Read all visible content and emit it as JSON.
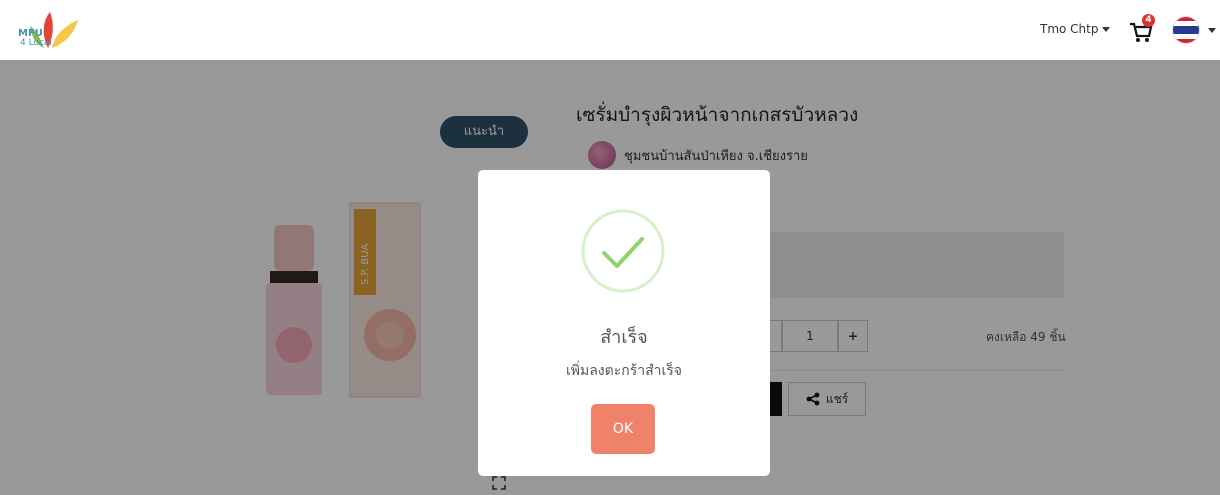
{
  "header": {
    "logo_text_line1": "MFU",
    "logo_text_line2": "4 Local",
    "user_name": "Tmo Chtp",
    "cart_count": "4",
    "language_flag": "thailand-flag-icon"
  },
  "product": {
    "badge": "แนะนำ",
    "title": "เซรั่มบำรุงผิวหน้าจากเกสรบัวหลวง",
    "shop_name": "ชุมชนบ้านสันป่าเหียง จ.เชียงราย",
    "quantity": "1",
    "quantity_plus": "+",
    "stock_text": "คงเหลือ 49 ชิ้น",
    "share_label": "แชร์",
    "box_label": "S.P. BUA"
  },
  "modal": {
    "title": "สำเร็จ",
    "message": "เพิ่มลงตะกร้าสำเร็จ",
    "ok_label": "OK"
  },
  "colors": {
    "overlay": "rgba(0,0,0,0.4)",
    "ok_button": "#f0826a",
    "success_green": "#8fd46a",
    "badge_bg": "#2f5368",
    "cart_badge": "#e03030"
  }
}
